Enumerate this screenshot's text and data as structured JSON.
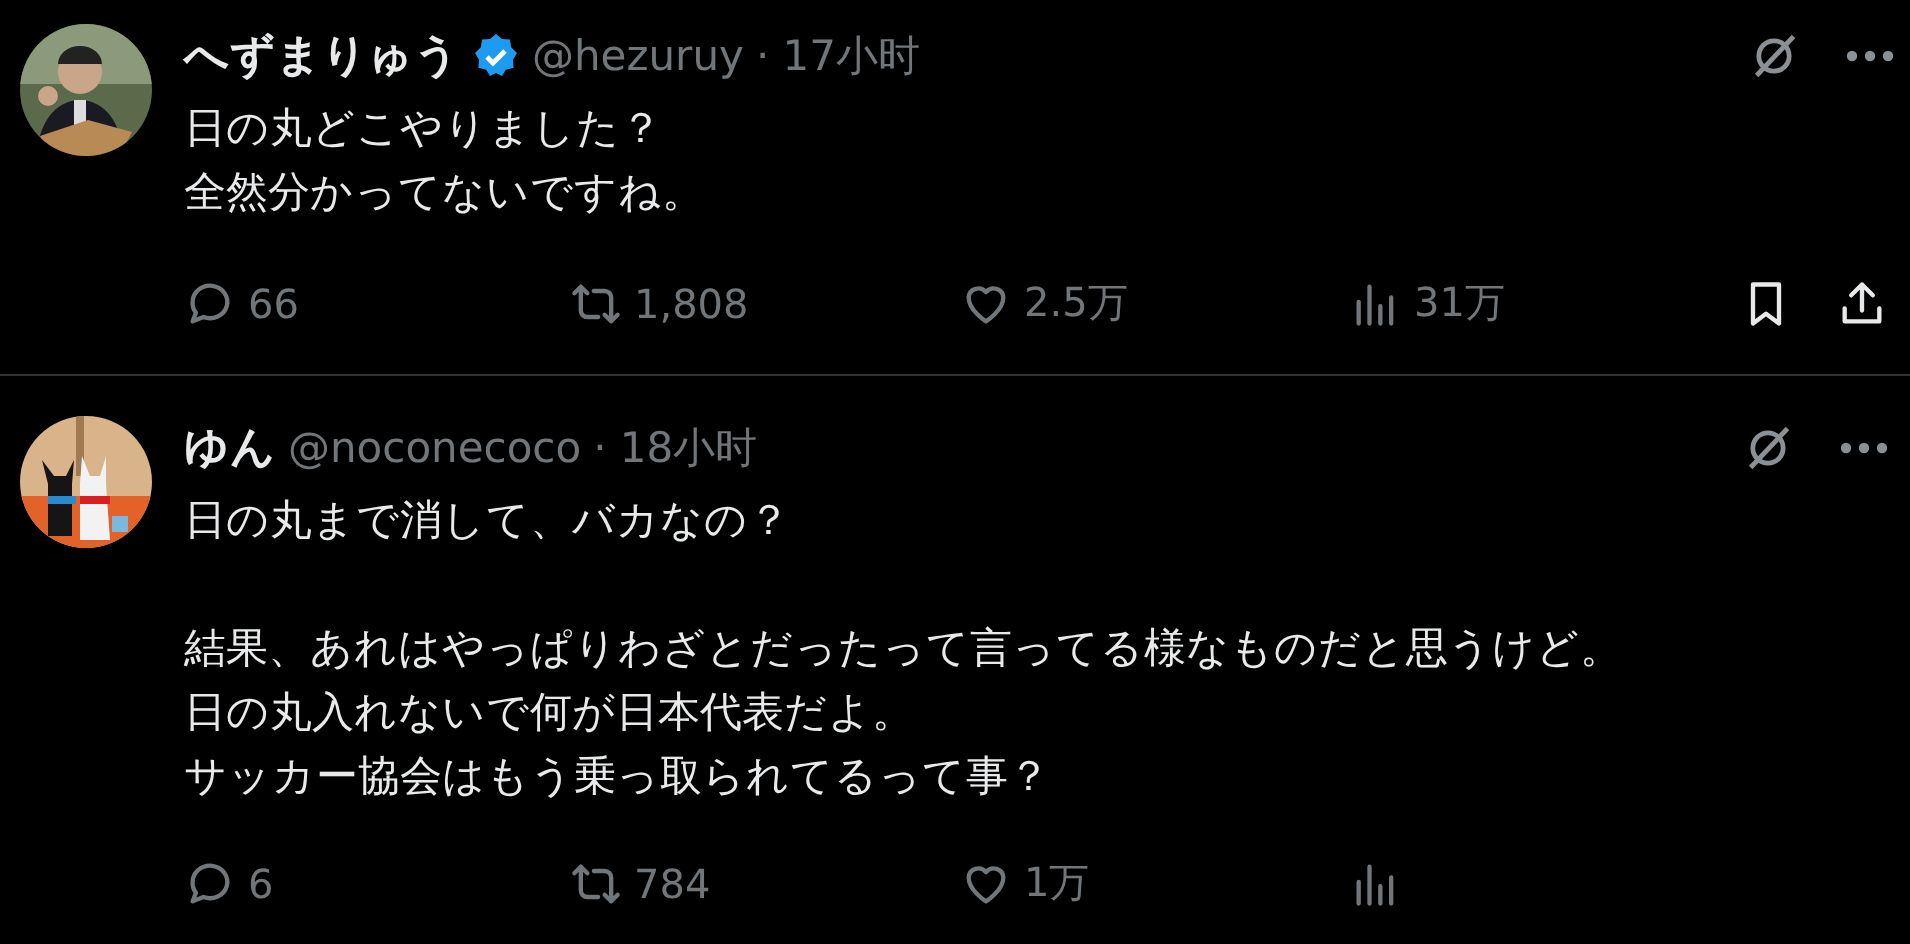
{
  "posts": [
    {
      "name": "へずまりゅう",
      "verified": true,
      "handle": "@hezuruy",
      "time": "· 17小时",
      "paragraphs": [
        [
          "日の丸どこやりました？",
          "全然分かってないですね。"
        ]
      ],
      "actions": [
        {
          "kind": "reply",
          "count": "66"
        },
        {
          "kind": "repost",
          "count": "1,808"
        },
        {
          "kind": "like",
          "count": "2.5万"
        },
        {
          "kind": "views",
          "count": "31万"
        },
        {
          "kind": "bookmark"
        },
        {
          "kind": "share"
        }
      ]
    },
    {
      "name": "ゆん",
      "verified": false,
      "handle": "@noconecoco",
      "time": "· 18小时",
      "paragraphs": [
        [
          "日の丸まで消して、バカなの？"
        ],
        [
          "結果、あれはやっぱりわざとだったって言ってる様なものだと思うけど。",
          "日の丸入れないで何が日本代表だよ。",
          "サッカー協会はもう乗っ取られてるって事？"
        ]
      ],
      "actions": [
        {
          "kind": "reply",
          "count": "6"
        },
        {
          "kind": "repost",
          "count": "784"
        },
        {
          "kind": "like",
          "count": "1万"
        },
        {
          "kind": "views"
        }
      ]
    }
  ]
}
